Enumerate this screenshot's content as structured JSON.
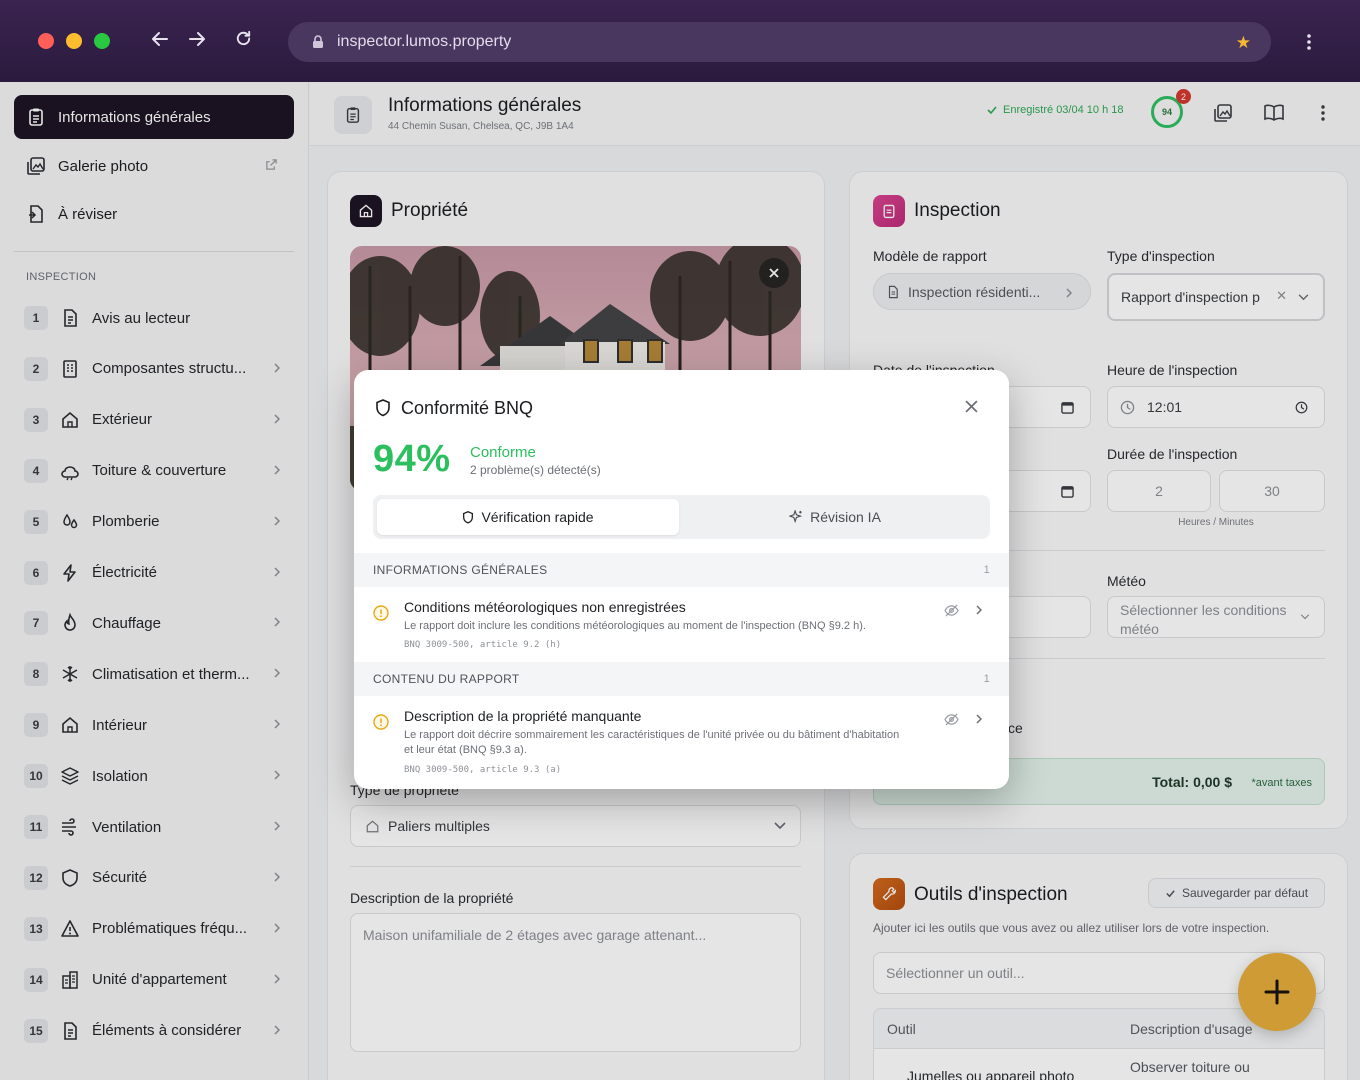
{
  "browser": {
    "url": "inspector.lumos.property"
  },
  "sidebar": {
    "top": [
      {
        "label": "Informations générales"
      },
      {
        "label": "Galerie photo"
      },
      {
        "label": "À réviser"
      }
    ],
    "section_label": "INSPECTION",
    "items": [
      {
        "num": "1",
        "label": "Avis au lecteur",
        "icon": "document-icon"
      },
      {
        "num": "2",
        "label": "Composantes structu...",
        "icon": "building-icon"
      },
      {
        "num": "3",
        "label": "Extérieur",
        "icon": "home-icon"
      },
      {
        "num": "4",
        "label": "Toiture & couverture",
        "icon": "roof-rain-icon"
      },
      {
        "num": "5",
        "label": "Plomberie",
        "icon": "droplets-icon"
      },
      {
        "num": "6",
        "label": "Électricité",
        "icon": "lightning-icon"
      },
      {
        "num": "7",
        "label": "Chauffage",
        "icon": "flame-icon"
      },
      {
        "num": "8",
        "label": "Climatisation et therm...",
        "icon": "snowflake-icon"
      },
      {
        "num": "9",
        "label": "Intérieur",
        "icon": "home-icon"
      },
      {
        "num": "10",
        "label": "Isolation",
        "icon": "layers-icon"
      },
      {
        "num": "11",
        "label": "Ventilation",
        "icon": "wind-icon"
      },
      {
        "num": "12",
        "label": "Sécurité",
        "icon": "shield-icon"
      },
      {
        "num": "13",
        "label": "Problématiques fréqu...",
        "icon": "warning-icon"
      },
      {
        "num": "14",
        "label": "Unité d'appartement",
        "icon": "apartment-icon"
      },
      {
        "num": "15",
        "label": "Éléments à considérer",
        "icon": "document-icon"
      }
    ]
  },
  "header": {
    "title": "Informations générales",
    "address": "44 Chemin Susan, Chelsea, QC, J9B 1A4",
    "saved": "Enregistré 03/04 10 h 18",
    "score": "94",
    "badge": "2"
  },
  "property": {
    "title": "Propriété",
    "type_label": "Type de propriété",
    "type_value": "Paliers multiples",
    "description_label": "Description de la propriété",
    "description_placeholder": "Maison unifamiliale de 2 étages avec garage attenant..."
  },
  "inspection": {
    "title": "Inspection",
    "template_label": "Modèle de rapport",
    "template_value": "Inspection résidenti...",
    "type_label": "Type d'inspection",
    "type_value": "Rapport d'inspection p",
    "date_label": "Date de l'inspection",
    "time_label": "Heure de l'inspection",
    "time_value": "12:01",
    "duration_label": "Durée de l'inspection",
    "hours": "2",
    "minutes": "30",
    "duration_hint": "Heures / Minutes",
    "weather_label": "Météo",
    "weather_placeholder": "Sélectionner les conditions météo",
    "partial_text": "ce",
    "total": "Total: 0,00 $",
    "total_note": "*avant taxes"
  },
  "tools": {
    "title": "Outils d'inspection",
    "save_default": "Sauvegarder par défaut",
    "help": "Ajouter ici les outils que vous avez ou allez utiliser lors de votre inspection.",
    "select_placeholder": "Sélectionner un outil...",
    "col_tool": "Outil",
    "col_desc": "Description d'usage",
    "row_tool": "Jumelles ou appareil photo",
    "row_desc": "Observer toiture ou"
  },
  "modal": {
    "title": "Conformité BNQ",
    "score": "94%",
    "status": "Conforme",
    "issues_count": "2 problème(s) détecté(s)",
    "tab_quick": "Vérification rapide",
    "tab_ai": "Révision IA",
    "sections": [
      {
        "title": "INFORMATIONS GÉNÉRALES",
        "count": "1",
        "issue_title": "Conditions météorologiques non enregistrées",
        "issue_desc": "Le rapport doit inclure les conditions météorologiques au moment de l'inspection (BNQ §9.2 h).",
        "issue_ref": "BNQ 3009-500, article 9.2 (h)"
      },
      {
        "title": "CONTENU DU RAPPORT",
        "count": "1",
        "issue_title": "Description de la propriété manquante",
        "issue_desc": "Le rapport doit décrire sommairement les caractéristiques de l'unité privée ou du bâtiment d'habitation et leur état (BNQ §9.3 a).",
        "issue_ref": "BNQ 3009-500, article 9.3 (a)"
      }
    ]
  },
  "colors": {
    "accent": "#1e1525",
    "success": "#2bbf5e",
    "warning": "#e6a817",
    "fab": "#e6ad3a"
  }
}
